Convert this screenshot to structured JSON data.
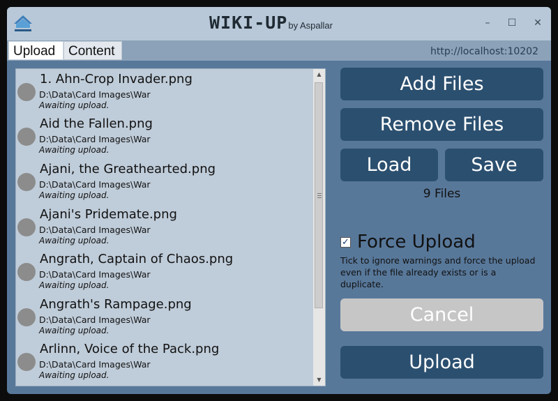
{
  "window": {
    "title": "WIKI-UP",
    "subtitle": "by Aspallar",
    "app_icon": "upload-cloud-icon",
    "controls": [
      "minimize-icon",
      "maximize-icon",
      "close-icon"
    ],
    "minimize_glyph": "–",
    "maximize_glyph": "☐",
    "close_glyph": "✕"
  },
  "tabs": [
    {
      "label": "Upload",
      "selected": true
    },
    {
      "label": "Content",
      "selected": false
    }
  ],
  "server_url": "http://localhost:10202",
  "files": [
    {
      "name": "1. Ahn-Crop Invader.png",
      "path": "D:\\Data\\Card Images\\War",
      "status": "Awaiting upload."
    },
    {
      "name": "Aid the Fallen.png",
      "path": "D:\\Data\\Card Images\\War",
      "status": "Awaiting upload."
    },
    {
      "name": "Ajani, the Greathearted.png",
      "path": "D:\\Data\\Card Images\\War",
      "status": "Awaiting upload."
    },
    {
      "name": "Ajani's Pridemate.png",
      "path": "D:\\Data\\Card Images\\War",
      "status": "Awaiting upload."
    },
    {
      "name": "Angrath, Captain of Chaos.png",
      "path": "D:\\Data\\Card Images\\War",
      "status": "Awaiting upload."
    },
    {
      "name": "Angrath's Rampage.png",
      "path": "D:\\Data\\Card Images\\War",
      "status": "Awaiting upload."
    },
    {
      "name": "Arlinn, Voice of the Pack.png",
      "path": "D:\\Data\\Card Images\\War",
      "status": "Awaiting upload."
    }
  ],
  "buttons": {
    "add_files": "Add Files",
    "remove_files": "Remove Files",
    "load": "Load",
    "save": "Save",
    "cancel": "Cancel",
    "upload": "Upload"
  },
  "file_count": "9 Files",
  "force_upload": {
    "label": "Force Upload",
    "checked": true,
    "help": "Tick to ignore warnings and force the upload even if the file already exists or is a duplicate."
  },
  "colors": {
    "button": "#2b4f6f",
    "button_disabled": "#c6c6c6",
    "background": "#58789a",
    "list_background": "#bfccd9"
  }
}
